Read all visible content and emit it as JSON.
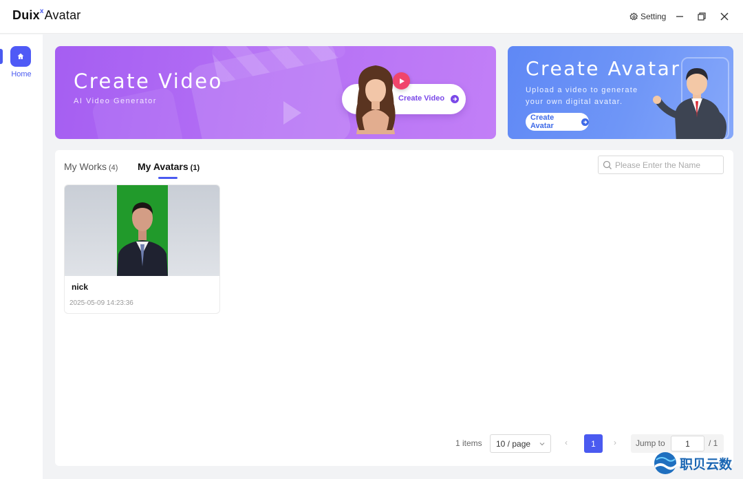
{
  "app": {
    "title_prefix": "Duix",
    "title_mark": "x",
    "title_suffix": "Avatar",
    "setting_label": "Setting"
  },
  "sidebar": {
    "items": [
      {
        "label": "Home",
        "icon": "home-icon",
        "active": true
      }
    ]
  },
  "banners": {
    "video": {
      "title": "Create Video",
      "subtitle": "AI Video Generator",
      "button_label": "Create Video"
    },
    "avatar": {
      "title": "Create Avatar",
      "subtitle": "Upload a video to generate your own digital avatar.",
      "button_label": "Create Avatar"
    }
  },
  "tabs": [
    {
      "label": "My Works",
      "count": "(4)",
      "active": false
    },
    {
      "label": "My Avatars",
      "count": "(1)",
      "active": true
    }
  ],
  "search": {
    "placeholder": "Please Enter the Name",
    "value": ""
  },
  "avatars": [
    {
      "name": "nick",
      "created": "2025-05-09 14:23:36"
    }
  ],
  "pagination": {
    "total_label": "1 items",
    "page_size_label": "10 / page",
    "prev": "‹",
    "current_page": "1",
    "next": "›",
    "jump_label": "Jump to",
    "jump_value": "1",
    "total_pages_label": "/ 1"
  },
  "watermark": {
    "text": "职贝云数"
  },
  "colors": {
    "accent": "#4a5af0",
    "video_banner": "#b26df4",
    "avatar_banner": "#6f96f7",
    "background": "#f2f3f5"
  }
}
